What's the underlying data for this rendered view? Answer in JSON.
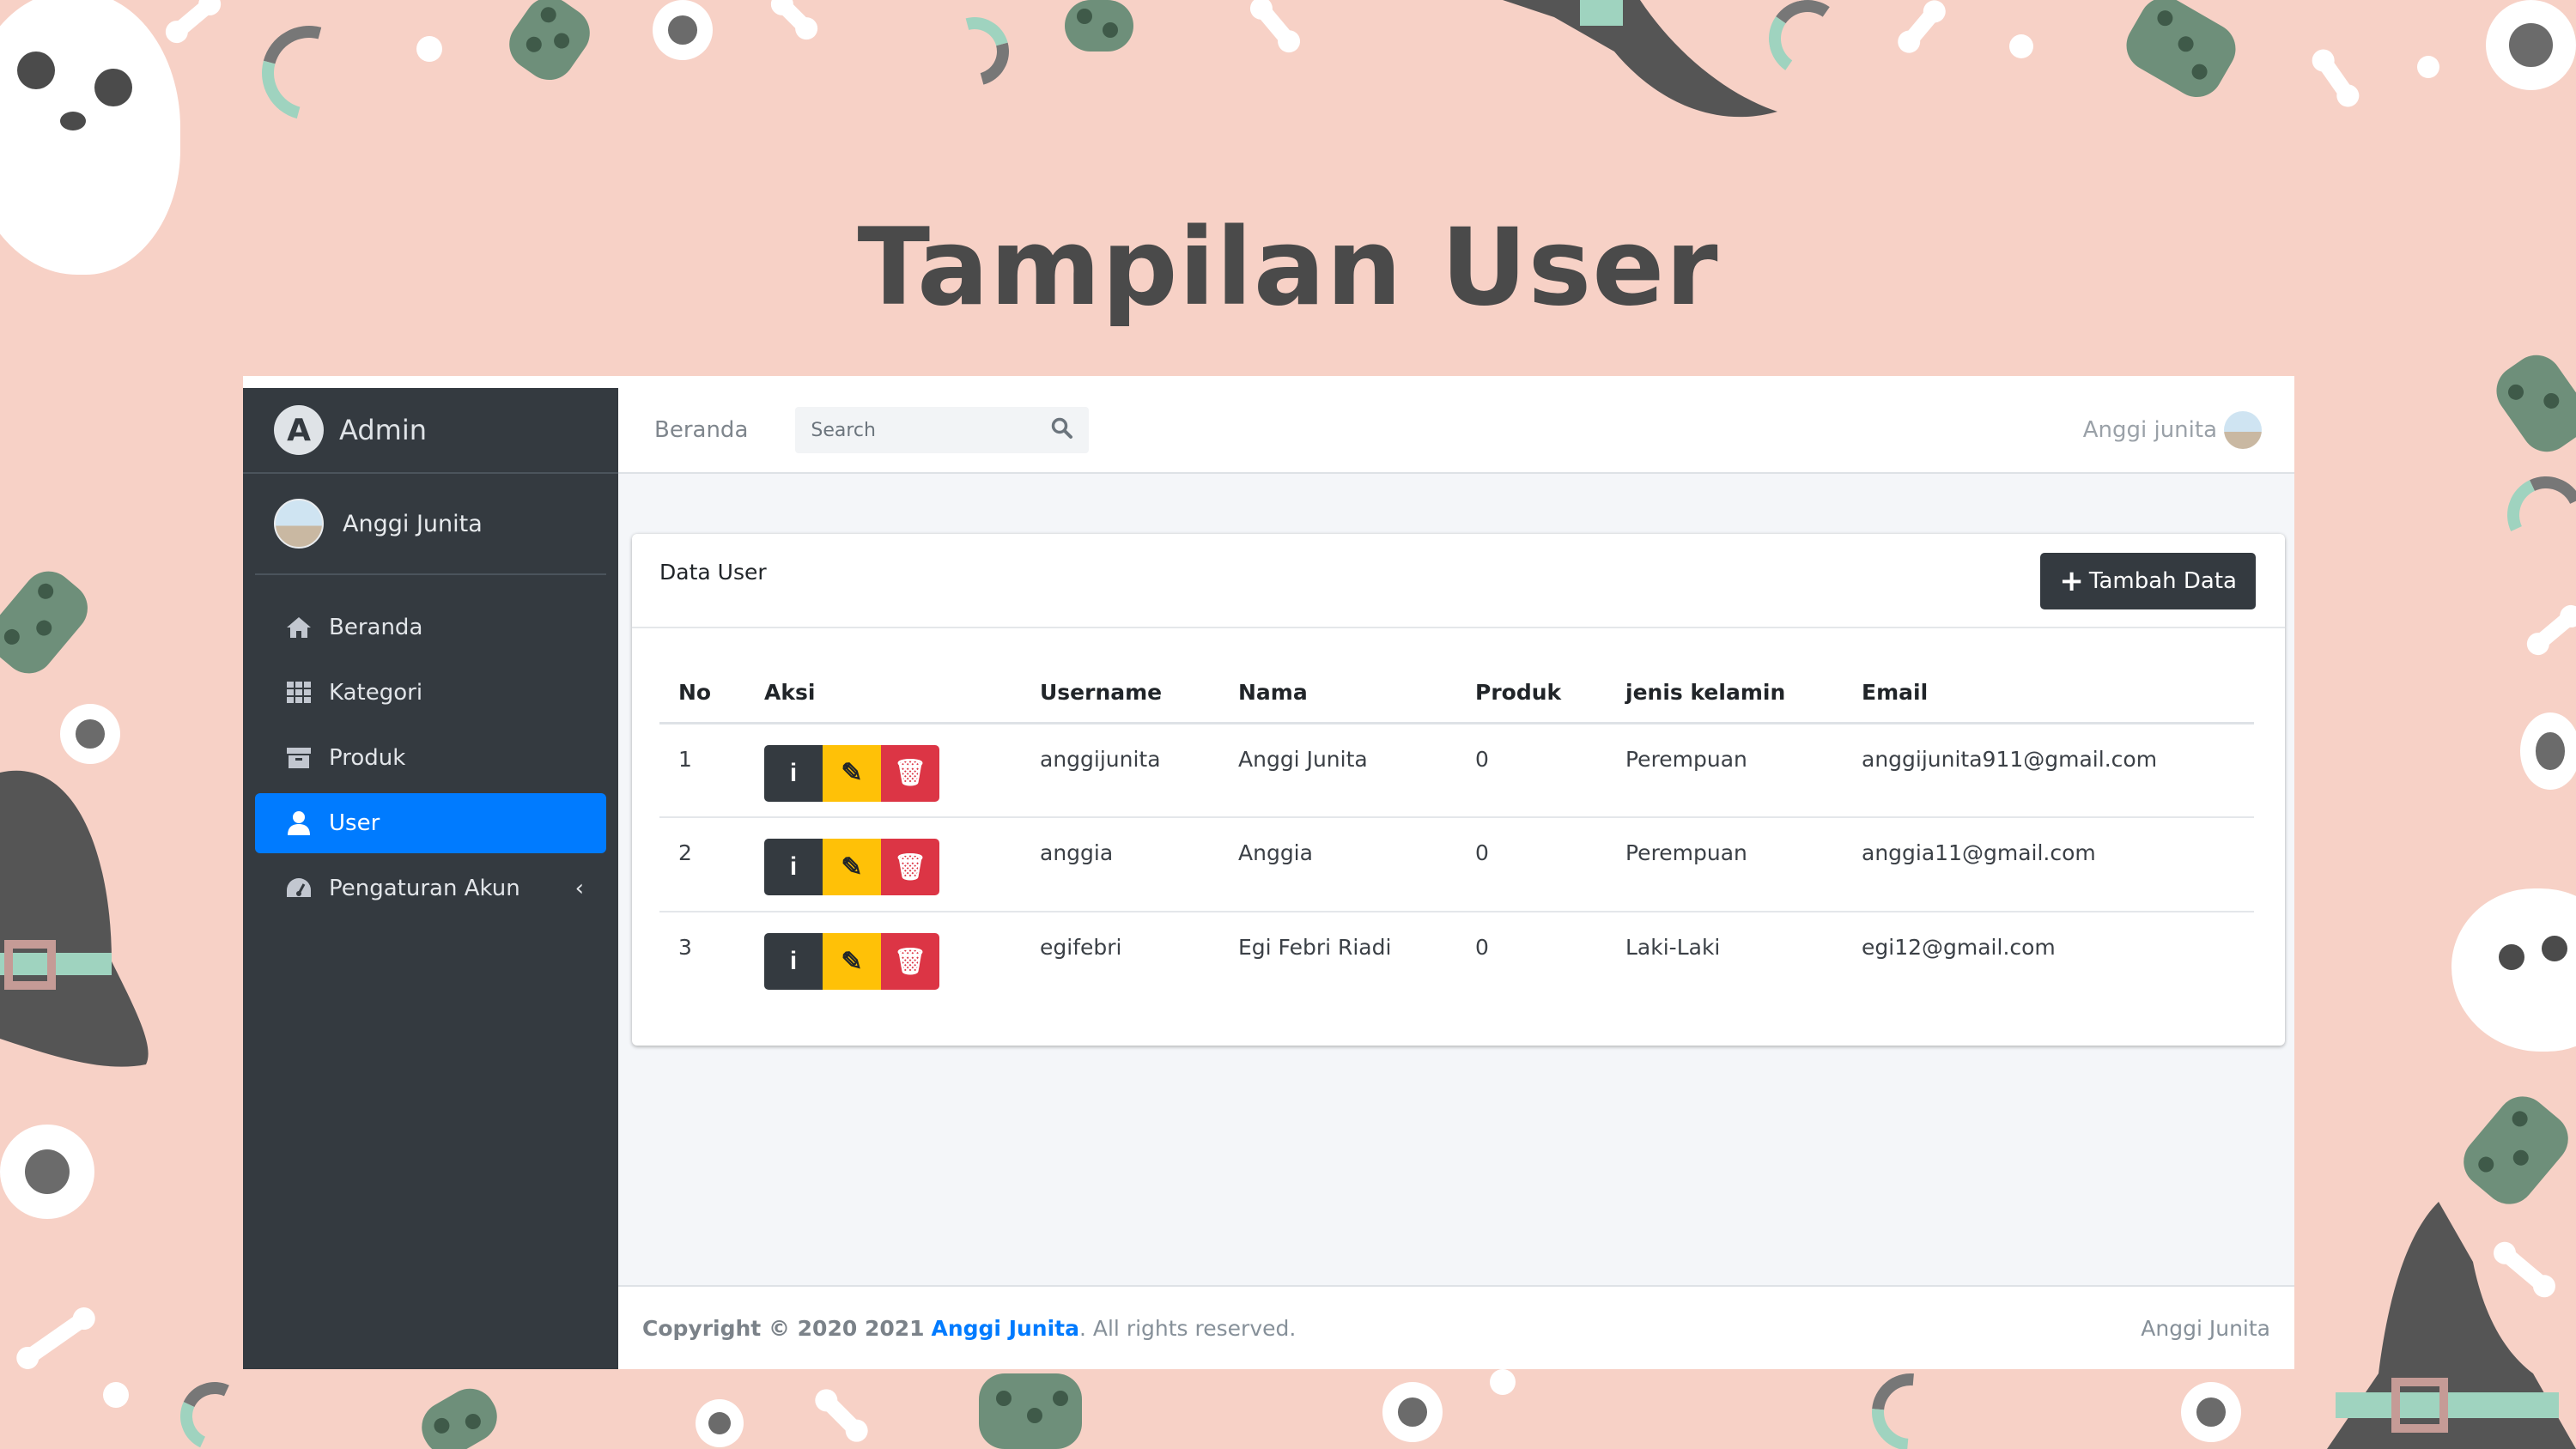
{
  "slide": {
    "title": "Tampilan User"
  },
  "sidebar": {
    "brand": "Admin",
    "user": "Anggi Junita",
    "items": [
      {
        "label": "Beranda",
        "icon": "home-icon"
      },
      {
        "label": "Kategori",
        "icon": "grid-icon"
      },
      {
        "label": "Produk",
        "icon": "archive-icon"
      },
      {
        "label": "User",
        "icon": "user-icon",
        "active": true
      },
      {
        "label": "Pengaturan Akun",
        "icon": "dashboard-icon"
      }
    ]
  },
  "topbar": {
    "home_link": "Beranda",
    "search_placeholder": "Search",
    "user": "Anggi junita"
  },
  "card": {
    "title": "Data User",
    "add_button": "Tambah Data",
    "columns": [
      "No",
      "Aksi",
      "Username",
      "Nama",
      "Produk",
      "jenis kelamin",
      "Email"
    ],
    "rows": [
      {
        "no": "1",
        "username": "anggijunita",
        "nama": "Anggi Junita",
        "produk": "0",
        "jk": "Perempuan",
        "email": "anggijunita911@gmail.com"
      },
      {
        "no": "2",
        "username": "anggia",
        "nama": "Anggia",
        "produk": "0",
        "jk": "Perempuan",
        "email": "anggia11@gmail.com"
      },
      {
        "no": "3",
        "username": "egifebri",
        "nama": "Egi Febri Riadi",
        "produk": "0",
        "jk": "Laki-Laki",
        "email": "egi12@gmail.com"
      }
    ]
  },
  "footer": {
    "copyright_prefix": "Copyright © 2020 2021",
    "brand": "Anggi Junita",
    "suffix": ". All rights reserved.",
    "right": "Anggi Junita"
  },
  "colors": {
    "background": "#f7d1c6",
    "sidebar": "#343a40",
    "active": "#007bff",
    "warning": "#ffc107",
    "danger": "#dc3545"
  }
}
